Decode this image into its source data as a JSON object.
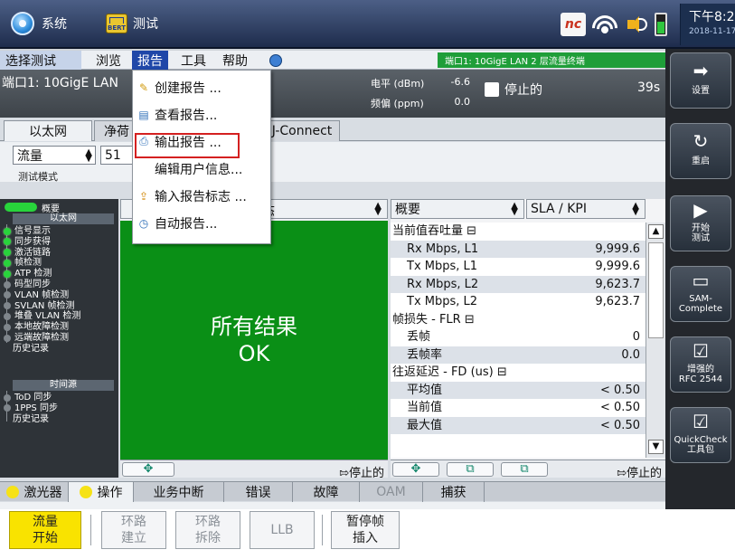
{
  "topbar": {
    "system_label": "系统",
    "test_label": "测试",
    "bert_label": "BERT",
    "nc_label": "nc",
    "time": "下午8:2",
    "date": "2018-11-17"
  },
  "menubar": {
    "items": [
      {
        "label": "选择测试"
      },
      {
        "label": "浏览"
      },
      {
        "label": "报告"
      },
      {
        "label": "工具"
      },
      {
        "label": "帮助"
      }
    ],
    "port_status": "端口1: 10GigE LAN 2 层流量终端"
  },
  "info": {
    "port": "端口1: 10GigE LAN",
    "level_label": "电平 (dBm)",
    "level_value": "-6.6",
    "freq_label": "频偏 (ppm)",
    "freq_value": "0.0",
    "stop_label": "停止的",
    "timer": "39s"
  },
  "tabs": {
    "items": [
      {
        "label": "以太网"
      },
      {
        "label": "净荷"
      },
      {
        "label": "J-Connect"
      }
    ]
  },
  "mode": {
    "traffic": "流量",
    "number": "51",
    "label": "测试模式"
  },
  "tree": {
    "summary": "概要",
    "section1": "以太网",
    "items": [
      {
        "label": "信号显示",
        "state": "green"
      },
      {
        "label": "同步获得",
        "state": "green"
      },
      {
        "label": "激活链路",
        "state": "green"
      },
      {
        "label": "帧检测",
        "state": "green"
      },
      {
        "label": "ATP 检测",
        "state": "green"
      },
      {
        "label": "码型同步",
        "state": "gray"
      },
      {
        "label": "VLAN 帧检测",
        "state": "gray"
      },
      {
        "label": "SVLAN 帧检测",
        "state": "gray"
      },
      {
        "label": "堆叠 VLAN 检测",
        "state": "gray"
      },
      {
        "label": "本地故障检测",
        "state": "gray"
      },
      {
        "label": "远端故障检测",
        "state": "gray"
      },
      {
        "label": "历史记录",
        "state": "none"
      }
    ],
    "section2": "时间源",
    "items2": [
      {
        "label": "ToD 同步",
        "state": "gray"
      },
      {
        "label": "1PPS 同步",
        "state": "gray"
      },
      {
        "label": "历史记录",
        "state": "none"
      }
    ]
  },
  "center": {
    "header": "态",
    "result_line1": "所有结果",
    "result_line2": "OK",
    "footer": "停止的"
  },
  "right": {
    "header1": "概要",
    "header2": "SLA / KPI",
    "rows": [
      {
        "k": "当前值吞吐量 ⊟",
        "v": "",
        "group": true
      },
      {
        "k": "Rx Mbps, L1",
        "v": "9,999.6",
        "group": false
      },
      {
        "k": "Tx Mbps, L1",
        "v": "9,999.6",
        "group": false
      },
      {
        "k": "Rx Mbps, L2",
        "v": "9,623.7",
        "group": false
      },
      {
        "k": "Tx Mbps, L2",
        "v": "9,623.7",
        "group": false
      },
      {
        "k": "帧损失 - FLR ⊟",
        "v": "",
        "group": true
      },
      {
        "k": "丢帧",
        "v": "0",
        "group": false
      },
      {
        "k": "丢帧率",
        "v": "0.0",
        "group": false
      },
      {
        "k": "往返延迟 - FD (us) ⊟",
        "v": "",
        "group": true
      },
      {
        "k": "平均值",
        "v": "< 0.50",
        "group": false
      },
      {
        "k": "当前值",
        "v": "< 0.50",
        "group": false
      },
      {
        "k": "最大值",
        "v": "< 0.50",
        "group": false
      }
    ],
    "footer": "停止的"
  },
  "bottom_tabs": {
    "items": [
      {
        "label": "激光器"
      },
      {
        "label": "操作"
      },
      {
        "label": "业务中断"
      },
      {
        "label": "错误"
      },
      {
        "label": "故障"
      },
      {
        "label": "OAM"
      },
      {
        "label": "捕获"
      }
    ]
  },
  "actions": {
    "traffic_start": "流量\n开始",
    "loop_up": "环路\n建立",
    "loop_down": "环路\n拆除",
    "llb": "LLB",
    "pause_insert": "暂停帧\n插入"
  },
  "sidebar": {
    "setup": "设置",
    "restart": "重启",
    "start_test": "开始\n测试",
    "sam": "SAM-\nComplete",
    "rfc": "增强的\nRFC 2544",
    "quickcheck": "QuickCheck\n工具包"
  },
  "dropdown": {
    "items": [
      {
        "label": "创建报告 ...",
        "icon": "pencil-icon"
      },
      {
        "label": "查看报告...",
        "icon": "document-icon"
      },
      {
        "label": "输出报告 ...",
        "icon": "printer-icon"
      },
      {
        "label": "编辑用户信息...",
        "icon": ""
      },
      {
        "label": "输入报告标志 ...",
        "icon": "import-icon"
      },
      {
        "label": "自动报告...",
        "icon": "clock-icon"
      }
    ],
    "highlighted_index": 2
  }
}
